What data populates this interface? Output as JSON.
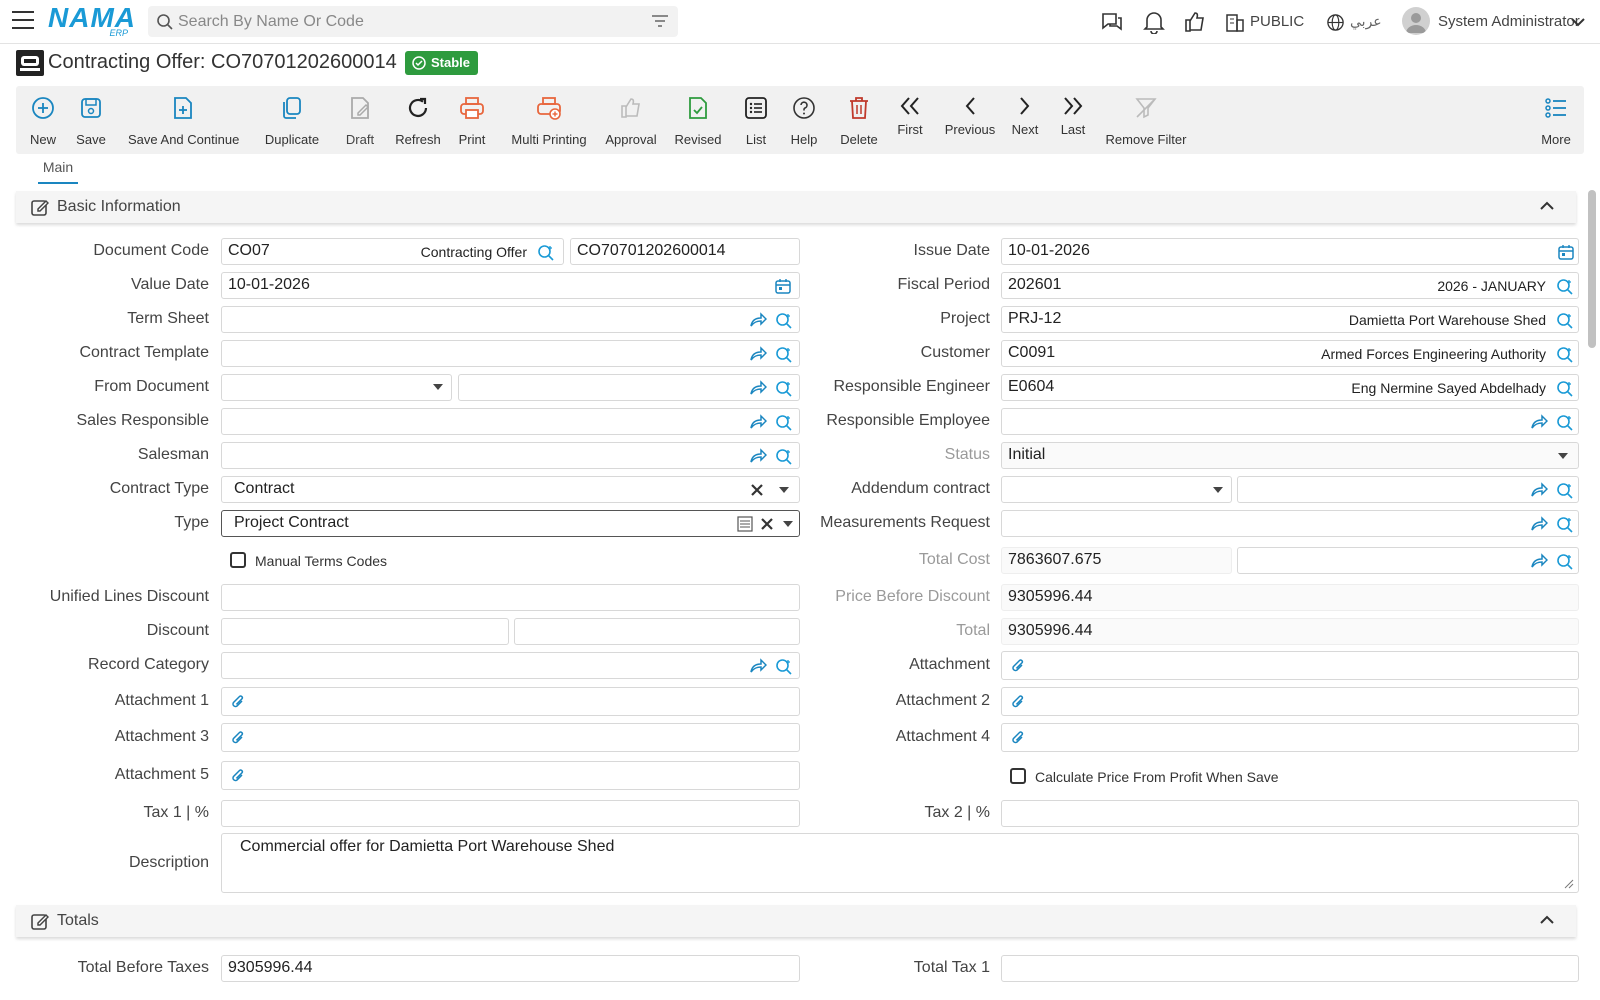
{
  "app": {
    "logo": "NAMA",
    "logo_sub": "ERP",
    "search_placeholder": "Search By Name Or Code",
    "branch": "PUBLIC",
    "language": "عربي",
    "user": "System Administrator"
  },
  "page": {
    "title": "Contracting Offer: CO70701202600014",
    "status_badge": "Stable"
  },
  "toolbar": {
    "new": "New",
    "save": "Save",
    "save_continue": "Save And Continue",
    "duplicate": "Duplicate",
    "draft": "Draft",
    "refresh": "Refresh",
    "print": "Print",
    "multi_printing": "Multi Printing",
    "approval": "Approval",
    "revised": "Revised",
    "list": "List",
    "help": "Help",
    "delete": "Delete",
    "first": "First",
    "previous": "Previous",
    "next": "Next",
    "last": "Last",
    "remove_filter": "Remove Filter",
    "more": "More"
  },
  "tabs": {
    "main": "Main"
  },
  "sections": {
    "basic": "Basic Information",
    "totals": "Totals"
  },
  "colors": {
    "accent": "#1a86c0",
    "badge_green": "#2e9b3e",
    "print_orange": "#e8663d",
    "delete_red": "#c0392b"
  },
  "form": {
    "labels": {
      "document_code": "Document Code",
      "value_date": "Value Date",
      "term_sheet": "Term Sheet",
      "contract_template": "Contract Template",
      "from_document": "From Document",
      "sales_responsible": "Sales Responsible",
      "salesman": "Salesman",
      "contract_type": "Contract Type",
      "type": "Type",
      "manual_terms_codes": "Manual Terms Codes",
      "unified_lines_discount": "Unified Lines Discount",
      "discount": "Discount",
      "record_category": "Record Category",
      "attachment1": "Attachment 1",
      "attachment3": "Attachment 3",
      "attachment5": "Attachment 5",
      "tax1": "Tax 1 | %",
      "description": "Description",
      "issue_date": "Issue Date",
      "fiscal_period": "Fiscal Period",
      "project": "Project",
      "customer": "Customer",
      "responsible_engineer": "Responsible Engineer",
      "responsible_employee": "Responsible Employee",
      "status": "Status",
      "addendum_contract": "Addendum contract",
      "measurements_request": "Measurements Request",
      "total_cost": "Total Cost",
      "price_before_discount": "Price Before Discount",
      "total": "Total",
      "attachment": "Attachment",
      "attachment2": "Attachment 2",
      "attachment4": "Attachment 4",
      "calc_price_profit": "Calculate Price From Profit When Save",
      "tax2": "Tax 2 | %",
      "total_before_taxes": "Total Before Taxes",
      "total_tax1": "Total Tax 1"
    },
    "values": {
      "document_code": "CO07",
      "document_code_name": "Contracting Offer",
      "document_number": "CO70701202600014",
      "value_date": "10-01-2026",
      "contract_type": "Contract",
      "type": "Project Contract",
      "issue_date": "10-01-2026",
      "fiscal_period": "202601",
      "fiscal_period_name": "2026 - JANUARY",
      "project": "PRJ-12",
      "project_name": "Damietta Port Warehouse Shed",
      "customer": "C0091",
      "customer_name": "Armed Forces Engineering Authority",
      "responsible_engineer": "E0604",
      "responsible_engineer_name": "Eng Nermine Sayed Abdelhady",
      "status": "Initial",
      "total_cost": "7863607.675",
      "price_before_discount": "9305996.44",
      "total": "9305996.44",
      "description": "Commercial offer for Damietta Port Warehouse Shed",
      "total_before_taxes": "9305996.44"
    }
  }
}
